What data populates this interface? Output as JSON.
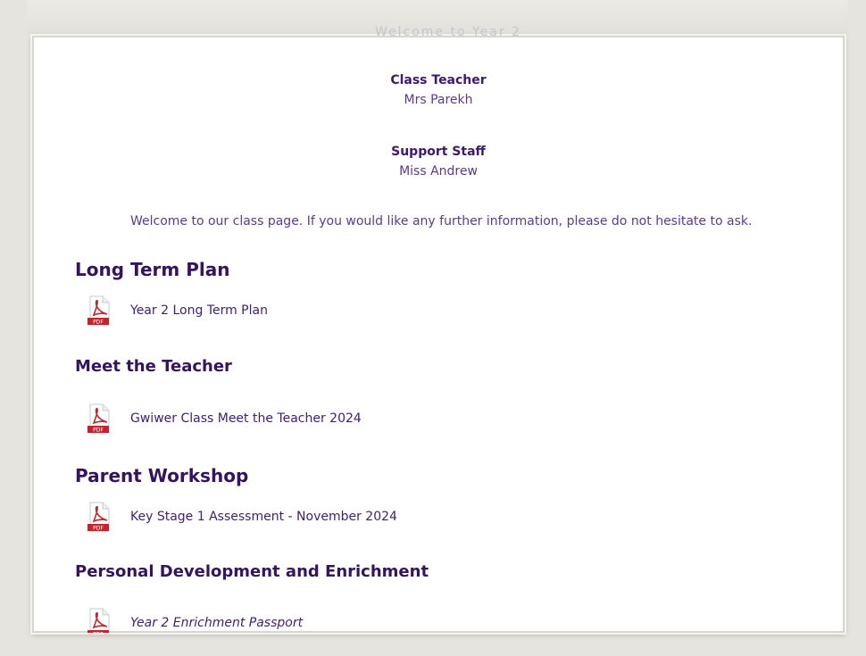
{
  "page": {
    "ghost_title": "Welcome to Year 2"
  },
  "staff": {
    "class_teacher_label": "Class Teacher",
    "class_teacher_name": "Mrs Parekh",
    "support_staff_label": "Support Staff",
    "support_staff_name": "Miss Andrew"
  },
  "welcome_text": "Welcome to our class page. If you would like any further information, please do not hesitate to ask.",
  "sections": [
    {
      "heading": "Long Term Plan",
      "doc": "Year 2 Long Term Plan"
    },
    {
      "heading": "Meet the Teacher",
      "doc": "Gwiwer Class Meet the Teacher 2024"
    },
    {
      "heading": "Parent Workshop",
      "doc": "Key Stage 1 Assessment - November 2024"
    },
    {
      "heading": "Personal Development and Enrichment",
      "doc": "Year 2 Enrichment Passport"
    }
  ],
  "icons": {
    "pdf": "pdf-file-icon"
  },
  "colors": {
    "heading": "#34145f",
    "text": "#5d3a8e",
    "pdf_red": "#c0272d"
  }
}
